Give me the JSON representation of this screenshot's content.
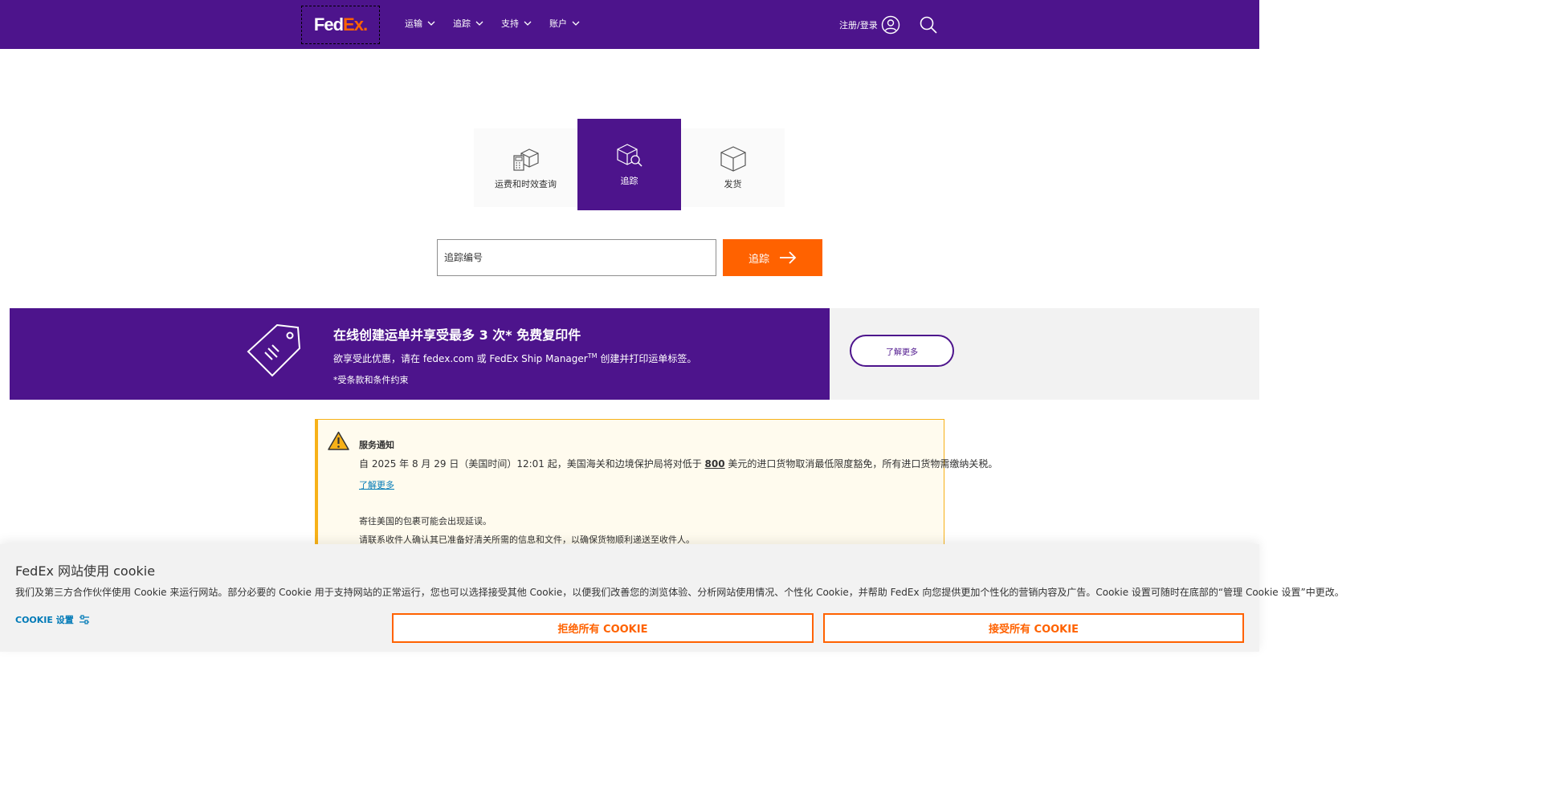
{
  "header": {
    "logo": {
      "fed": "Fed",
      "ex": "Ex."
    },
    "nav": [
      {
        "label": "运输",
        "icon": "chevron-down-icon"
      },
      {
        "label": "追踪",
        "icon": "chevron-down-icon"
      },
      {
        "label": "支持",
        "icon": "chevron-down-icon"
      },
      {
        "label": "账户",
        "icon": "chevron-down-icon"
      }
    ],
    "login_label": "注册/登录",
    "icons": {
      "login": "user-icon",
      "search": "search-icon"
    }
  },
  "tabs": [
    {
      "label": "运费和时效查询",
      "icon": "calculator-box-icon",
      "active": false
    },
    {
      "label": "追踪",
      "icon": "box-search-icon",
      "active": true
    },
    {
      "label": "发货",
      "icon": "box-icon",
      "active": false
    }
  ],
  "tracking": {
    "placeholder": "追踪编号",
    "button_label": "追踪"
  },
  "promo": {
    "title": "在线创建运单并享受最多 3 次* 免费复印件",
    "desc_before": "欲享受此优惠，请在 fedex.com 或 FedEx Ship Manager",
    "desc_sup": "TM",
    "desc_after": " 创建并打印运单标签。",
    "note": "*受条款和条件约束",
    "button_label": "了解更多",
    "icon": "price-tag-icon"
  },
  "alert": {
    "icon": "warning-icon",
    "title": "服务通知",
    "text_before": "自 2025 年 8 月 29 日（美国时间）12:01 起，美国海关和边境保护局将对低于 ",
    "text_bold": "800",
    "text_after": " 美元的进口货物取消最低限度豁免，所有进口货物需缴纳关税。",
    "link": "了解更多",
    "line2": "寄往美国的包裹可能会出现延误。",
    "line3": "请联系收件人确认其已准备好清关所需的信息和文件，以确保货物顺利递送至收件人。"
  },
  "cookie": {
    "title_prefix": "FedEx",
    "title_middle": "网站使用",
    "title_suffix": "cookie",
    "text": "我们及第三方合作伙伴使用 Cookie 来运行网站。部分必要的 Cookie 用于支持网站的正常运行，您也可以选择接受其他 Cookie，以便我们改善您的浏览体验、分析网站使用情况、个性化 Cookie，并帮助 FedEx 向您提供更加个性化的营销内容及广告。Cookie 设置可随时在底部的“管理 Cookie 设置”中更改。",
    "settings_label": "COOKIE 设置",
    "settings_icon": "sliders-icon",
    "reject_label": "拒绝所有 COOKIE",
    "accept_label": "接受所有 COOKIE"
  },
  "colors": {
    "purple": "#4d148c",
    "orange": "#ff6200",
    "alert_yellow": "#f7b118",
    "link_blue": "#007ab7"
  }
}
